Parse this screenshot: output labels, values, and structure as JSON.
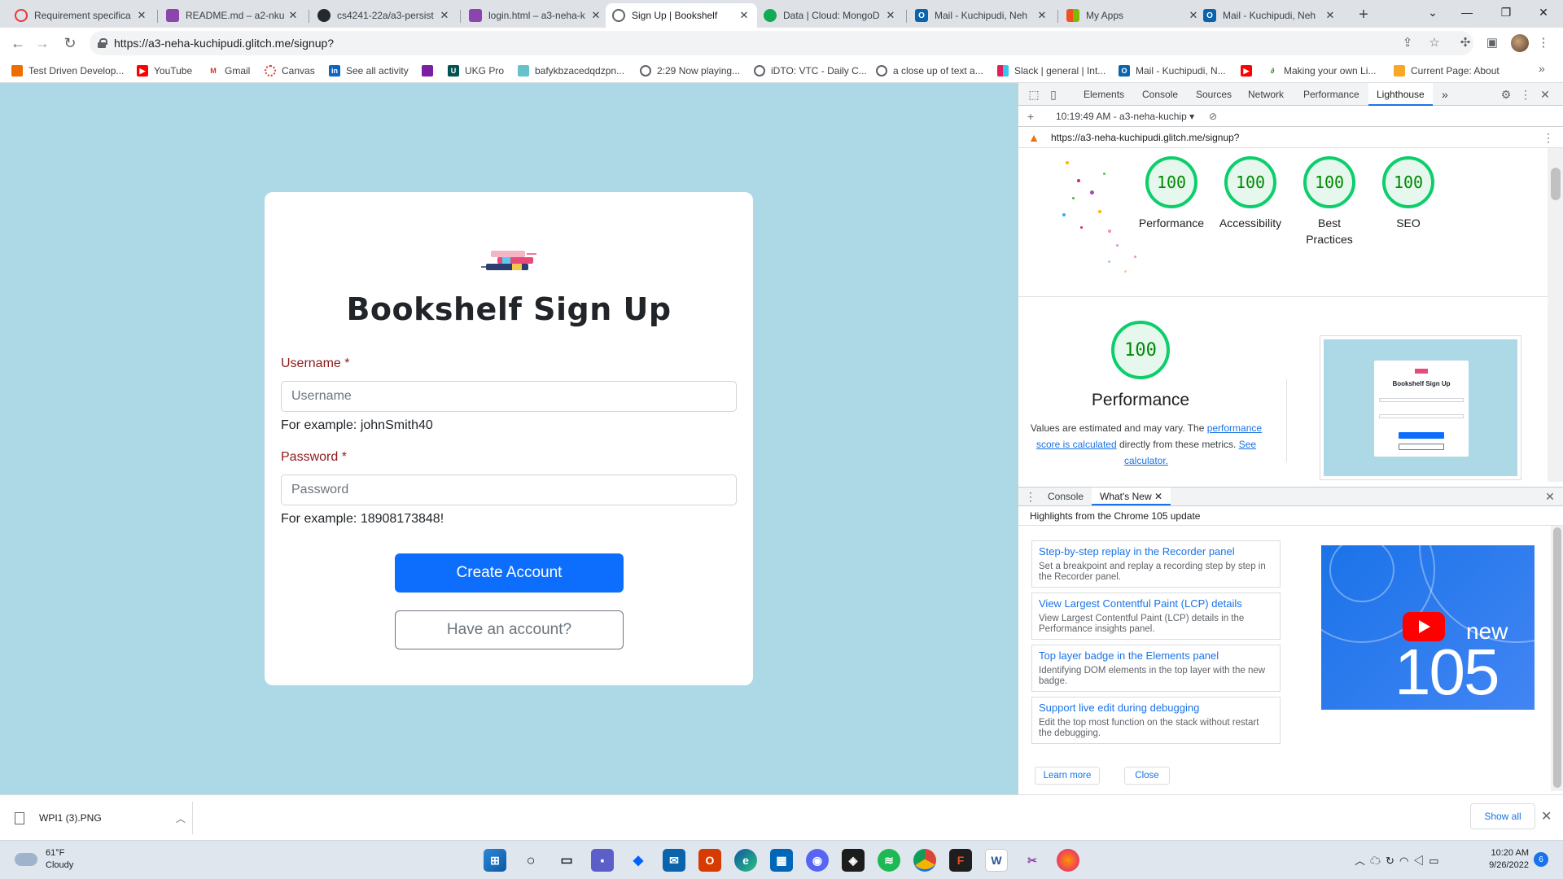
{
  "browser": {
    "tabs": [
      {
        "title": "Requirement specifica",
        "icon": "loading-icon",
        "color": "#e53935"
      },
      {
        "title": "README.md – a2-nku",
        "icon": "glitch-icon",
        "color": "#8e44ad"
      },
      {
        "title": "cs4241-22a/a3-persist",
        "icon": "github-icon",
        "color": "#24292e"
      },
      {
        "title": "login.html – a3-neha-k",
        "icon": "glitch-icon",
        "color": "#8e44ad"
      },
      {
        "title": "Sign Up | Bookshelf",
        "icon": "globe-icon",
        "color": "#5f6368"
      },
      {
        "title": "Data | Cloud: MongoD",
        "icon": "mongodb-icon",
        "color": "#13aa52"
      },
      {
        "title": "Mail - Kuchipudi, Neh",
        "icon": "outlook-icon",
        "color": "#0a64ad"
      },
      {
        "title": "My Apps",
        "icon": "microsoft-icon",
        "color": "#f25022"
      },
      {
        "title": "Mail - Kuchipudi, Neh",
        "icon": "outlook-icon",
        "color": "#0a64ad"
      }
    ],
    "active_tab_index": 4,
    "new_tab": "+",
    "url": "https://a3-neha-kuchipudi.glitch.me/signup?",
    "bookmarks": [
      {
        "label": "Test Driven Develop...",
        "icon": "bookmark-icon",
        "color": "#ef6c00"
      },
      {
        "label": "YouTube",
        "icon": "youtube-icon",
        "color": "#ff0000"
      },
      {
        "label": "Gmail",
        "icon": "gmail-icon",
        "color": "#d93025"
      },
      {
        "label": "Canvas",
        "icon": "canvas-icon",
        "color": "#e53935"
      },
      {
        "label": "See all activity",
        "icon": "linkedin-icon",
        "color": "#0a66c2"
      },
      {
        "label": "",
        "icon": "bookmark-icon",
        "color": "#7b1fa2"
      },
      {
        "label": "UKG Pro",
        "icon": "ukg-icon",
        "color": "#005151"
      },
      {
        "label": "bafykbzacedqdzpn...",
        "icon": "ipfs-icon",
        "color": "#65c2cb"
      },
      {
        "label": "2:29 Now playing...",
        "icon": "globe-icon",
        "color": "#5f6368"
      },
      {
        "label": "iDTO: VTC - Daily C...",
        "icon": "globe-icon",
        "color": "#5f6368"
      },
      {
        "label": "a close up of text a...",
        "icon": "globe-icon",
        "color": "#5f6368"
      },
      {
        "label": "Slack | general | Int...",
        "icon": "slack-icon",
        "color": "#e01e5a"
      },
      {
        "label": "Mail - Kuchipudi, N...",
        "icon": "outlook-icon",
        "color": "#0a64ad"
      },
      {
        "label": "",
        "icon": "youtube-icon",
        "color": "#ff0000"
      },
      {
        "label": "Making your own Li...",
        "icon": "bookmark-icon",
        "color": "#2e7d32"
      },
      {
        "label": "Current Page: About",
        "icon": "bookmark-icon",
        "color": "#f9a825"
      }
    ],
    "more_bookmarks": "»"
  },
  "page": {
    "title": "Bookshelf Sign Up",
    "username_label": "Username *",
    "username_placeholder": "Username",
    "username_help": "For example: johnSmith40",
    "password_label": "Password *",
    "password_placeholder": "Password",
    "password_help": "For example: 18908173848!",
    "create_button": "Create Account",
    "have_account_button": "Have an account?",
    "background_color": "#add8e6",
    "primary_color": "#0d6efd"
  },
  "devtools": {
    "tabs": [
      "Elements",
      "Console",
      "Sources",
      "Network",
      "Performance",
      "Lighthouse"
    ],
    "active_tab": "Lighthouse",
    "more_tabs": "»",
    "report_time": "10:19:49 AM - a3-neha-kuchip ▾",
    "report_url": "https://a3-neha-kuchipudi.glitch.me/signup?",
    "scores": [
      {
        "label": "Performance",
        "value": "100"
      },
      {
        "label": "Accessibility",
        "value": "100"
      },
      {
        "label": "Best Practices",
        "value": "100"
      },
      {
        "label": "SEO",
        "value": "100"
      }
    ],
    "perf_score": "100",
    "perf_title": "Performance",
    "perf_desc_1": "Values are estimated and may vary. The ",
    "perf_link_1": "performance score is calculated",
    "perf_desc_2": " directly from these metrics. ",
    "perf_link_2": "See calculator.",
    "thumb_title": "Bookshelf Sign Up",
    "score_color": "#0cce6b"
  },
  "drawer": {
    "tabs": [
      "Console",
      "What's New"
    ],
    "active_tab": "What's New",
    "heading": "Highlights from the Chrome 105 update",
    "items": [
      {
        "title": "Step-by-step replay in the Recorder panel",
        "desc": "Set a breakpoint and replay a recording step by step in the Recorder panel."
      },
      {
        "title": "View Largest Contentful Paint (LCP) details",
        "desc": "View Largest Contentful Paint (LCP) details in the Performance insights panel."
      },
      {
        "title": "Top layer badge in the Elements panel",
        "desc": "Identifying DOM elements in the top layer with the new badge."
      },
      {
        "title": "Support live edit during debugging",
        "desc": "Edit the top most function on the stack without restart the debugging."
      }
    ],
    "video_new": "new",
    "video_version": "105",
    "learn_more": "Learn more",
    "close": "Close"
  },
  "downloads": {
    "file": "WPI1 (3).PNG",
    "show_all": "Show all"
  },
  "taskbar": {
    "temp": "61°F",
    "condition": "Cloudy",
    "time": "10:20 AM",
    "date": "9/26/2022",
    "notifications": "6"
  }
}
